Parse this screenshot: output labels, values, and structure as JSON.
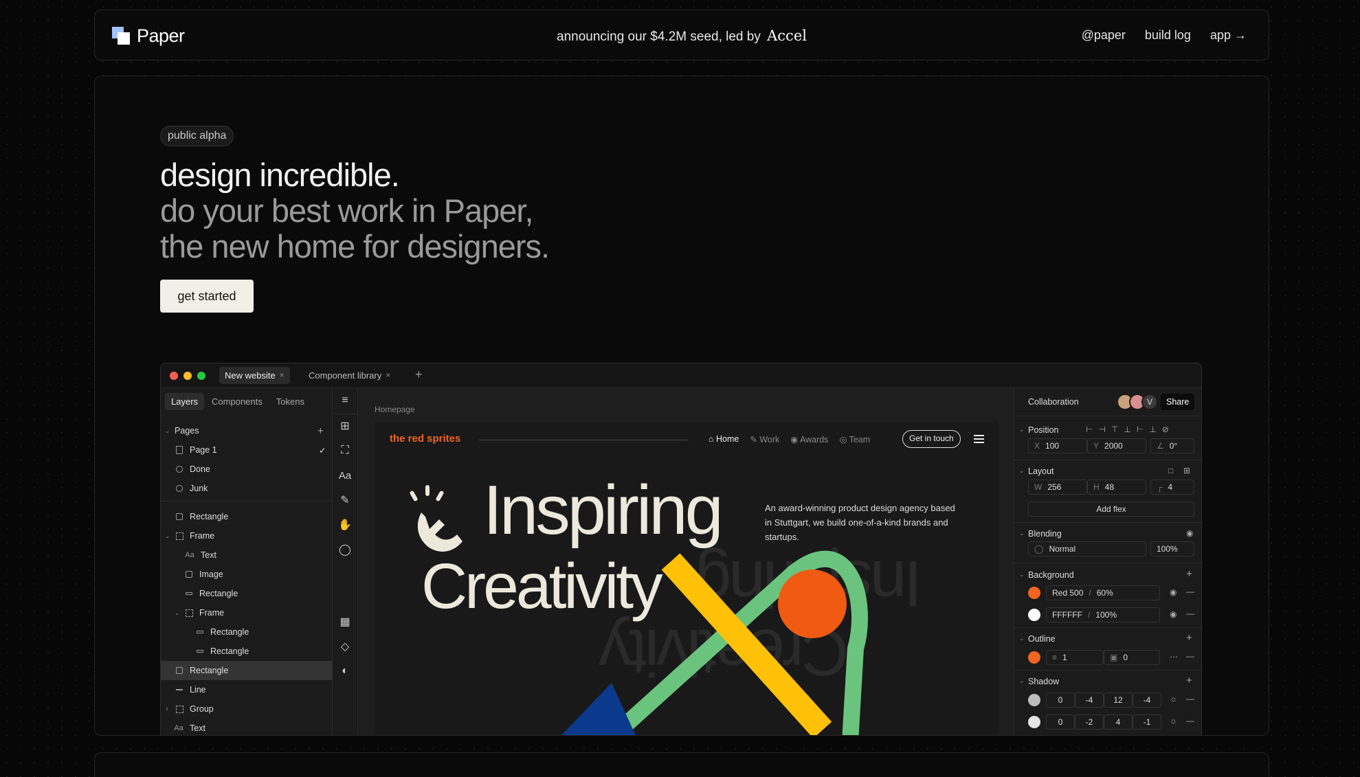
{
  "header": {
    "logo_text": "Paper",
    "announcement": "announcing our $4.2M seed, led by",
    "announcement_investor": "Accel",
    "links": [
      "@paper",
      "build log",
      "app →"
    ]
  },
  "hero": {
    "badge": "public alpha",
    "headline_1": "design incredible.",
    "headline_2": "do your best work in Paper,",
    "headline_3": "the new home for designers.",
    "cta": "get started"
  },
  "app": {
    "tabs": [
      {
        "label": "New website",
        "close": "×"
      },
      {
        "label": "Component library",
        "close": "×"
      }
    ],
    "tab_add": "+",
    "layers_panel": {
      "tabs": [
        "Layers",
        "Components",
        "Tokens"
      ],
      "pages_title": "Pages",
      "pages": [
        {
          "label": "Page 1",
          "check": "✓"
        },
        {
          "label": "Done"
        },
        {
          "label": "Junk"
        }
      ],
      "layers": [
        {
          "label": "Rectangle"
        },
        {
          "label": "Frame"
        },
        {
          "label": "Text"
        },
        {
          "label": "Image"
        },
        {
          "label": "Rectangle"
        },
        {
          "label": "Frame"
        },
        {
          "label": "Rectangle"
        },
        {
          "label": "Rectangle"
        },
        {
          "label": "Rectangle"
        },
        {
          "label": "Line"
        },
        {
          "label": "Group"
        },
        {
          "label": "Text"
        }
      ]
    },
    "canvas": {
      "breadcrumb": "Homepage",
      "site": {
        "brand": "the red sprites",
        "nav": [
          "Home",
          "Work",
          "Awards",
          "Team"
        ],
        "cta": "Get in touch",
        "heading_1": "Inspiring",
        "heading_2": "Creativity",
        "description": "An award-winning product design agency based in Stuttgart, we build one-of-a-kind brands and startups."
      }
    },
    "properties": {
      "collaboration": "Collaboration",
      "avatar_initial": "V",
      "share": "Share",
      "position": {
        "title": "Position",
        "x_label": "X",
        "x": "100",
        "y_label": "Y",
        "y": "2000",
        "rotation": "0°"
      },
      "layout": {
        "title": "Layout",
        "w_label": "W",
        "w": "256",
        "h_label": "H",
        "h": "48",
        "radius": "4",
        "add_flex": "Add flex"
      },
      "blending": {
        "title": "Blending",
        "mode": "Normal",
        "opacity": "100%"
      },
      "background": {
        "title": "Background",
        "fills": [
          {
            "color": "#f06522",
            "name": "Red 500",
            "opacity": "60%"
          },
          {
            "color": "#ffffff",
            "name": "FFFFFF",
            "opacity": "100%"
          }
        ]
      },
      "outline": {
        "title": "Outline",
        "color": "#f06522",
        "width": "1",
        "offset": "0"
      },
      "shadow": {
        "title": "Shadow",
        "rows": [
          {
            "color": "#bdbdbd",
            "values": [
              "0",
              "-4",
              "12",
              "-4"
            ]
          },
          {
            "color": "#e5e5e5",
            "values": [
              "0",
              "-2",
              "4",
              "-1"
            ]
          }
        ]
      }
    }
  },
  "colors": {
    "accent": "#f06522",
    "cta_bg": "#f1efe6",
    "logo_blue": "#a3c3ff"
  }
}
